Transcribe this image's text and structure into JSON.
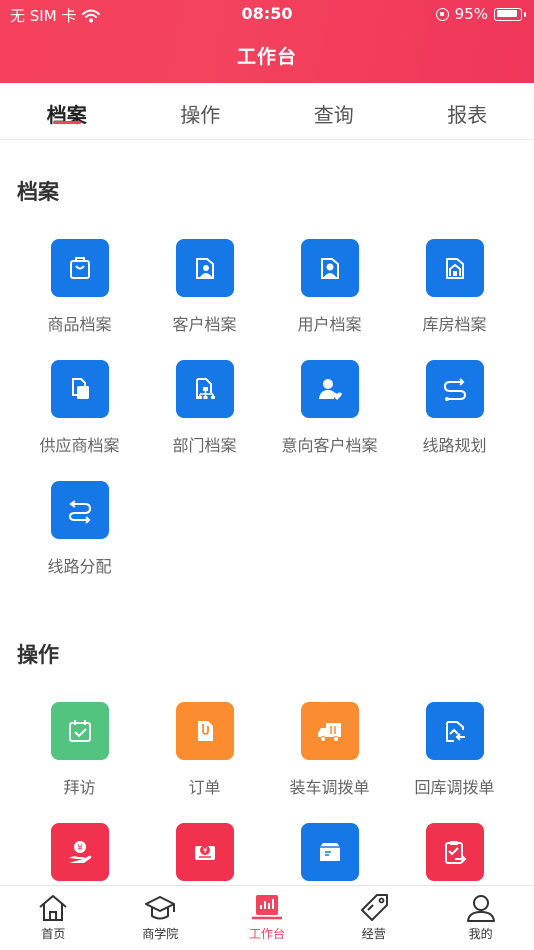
{
  "status_bar": {
    "carrier": "无 SIM 卡",
    "time": "08:50",
    "battery": "95%"
  },
  "nav": {
    "title": "工作台"
  },
  "tabs": [
    {
      "label": "档案",
      "active": true
    },
    {
      "label": "操作",
      "active": false
    },
    {
      "label": "查询",
      "active": false
    },
    {
      "label": "报表",
      "active": false
    }
  ],
  "sections": [
    {
      "title": "档案",
      "items": [
        {
          "label": "商品档案",
          "icon": "product-folder-icon",
          "color": "#1677e6"
        },
        {
          "label": "客户档案",
          "icon": "customer-folder-icon",
          "color": "#1677e6"
        },
        {
          "label": "用户档案",
          "icon": "user-folder-icon",
          "color": "#1677e6"
        },
        {
          "label": "库房档案",
          "icon": "warehouse-folder-icon",
          "color": "#1677e6"
        },
        {
          "label": "供应商档案",
          "icon": "supplier-folder-icon",
          "color": "#1677e6"
        },
        {
          "label": "部门档案",
          "icon": "department-folder-icon",
          "color": "#1677e6"
        },
        {
          "label": "意向客户档案",
          "icon": "prospect-customer-icon",
          "color": "#1677e6"
        },
        {
          "label": "线路规划",
          "icon": "route-planning-icon",
          "color": "#1677e6"
        },
        {
          "label": "线路分配",
          "icon": "route-assign-icon",
          "color": "#1677e6"
        }
      ]
    },
    {
      "title": "操作",
      "items": [
        {
          "label": "拜访",
          "icon": "visit-calendar-icon",
          "color": "#52c480"
        },
        {
          "label": "订单",
          "icon": "order-document-icon",
          "color": "#fb8c30"
        },
        {
          "label": "装车调拨单",
          "icon": "truck-loading-icon",
          "color": "#fb8c30"
        },
        {
          "label": "回库调拨单",
          "icon": "return-warehouse-icon",
          "color": "#1677e6"
        },
        {
          "label": "",
          "icon": "money-hand-icon",
          "color": "#f0324f"
        },
        {
          "label": "",
          "icon": "money-cart-icon",
          "color": "#f0324f"
        },
        {
          "label": "",
          "icon": "package-box-icon",
          "color": "#1677e6"
        },
        {
          "label": "",
          "icon": "clipboard-check-icon",
          "color": "#f0324f"
        }
      ]
    }
  ],
  "tabbar": [
    {
      "label": "首页",
      "icon": "home-icon",
      "active": false
    },
    {
      "label": "商学院",
      "icon": "graduation-cap-icon",
      "active": false
    },
    {
      "label": "工作台",
      "icon": "workbench-chart-icon",
      "active": true
    },
    {
      "label": "经营",
      "icon": "price-tag-icon",
      "active": false
    },
    {
      "label": "我的",
      "icon": "profile-icon",
      "active": false
    }
  ],
  "colors": {
    "brand": "#f3435d",
    "blue": "#1677e6",
    "green": "#52c480",
    "orange": "#fb8c30",
    "red": "#f0324f"
  }
}
